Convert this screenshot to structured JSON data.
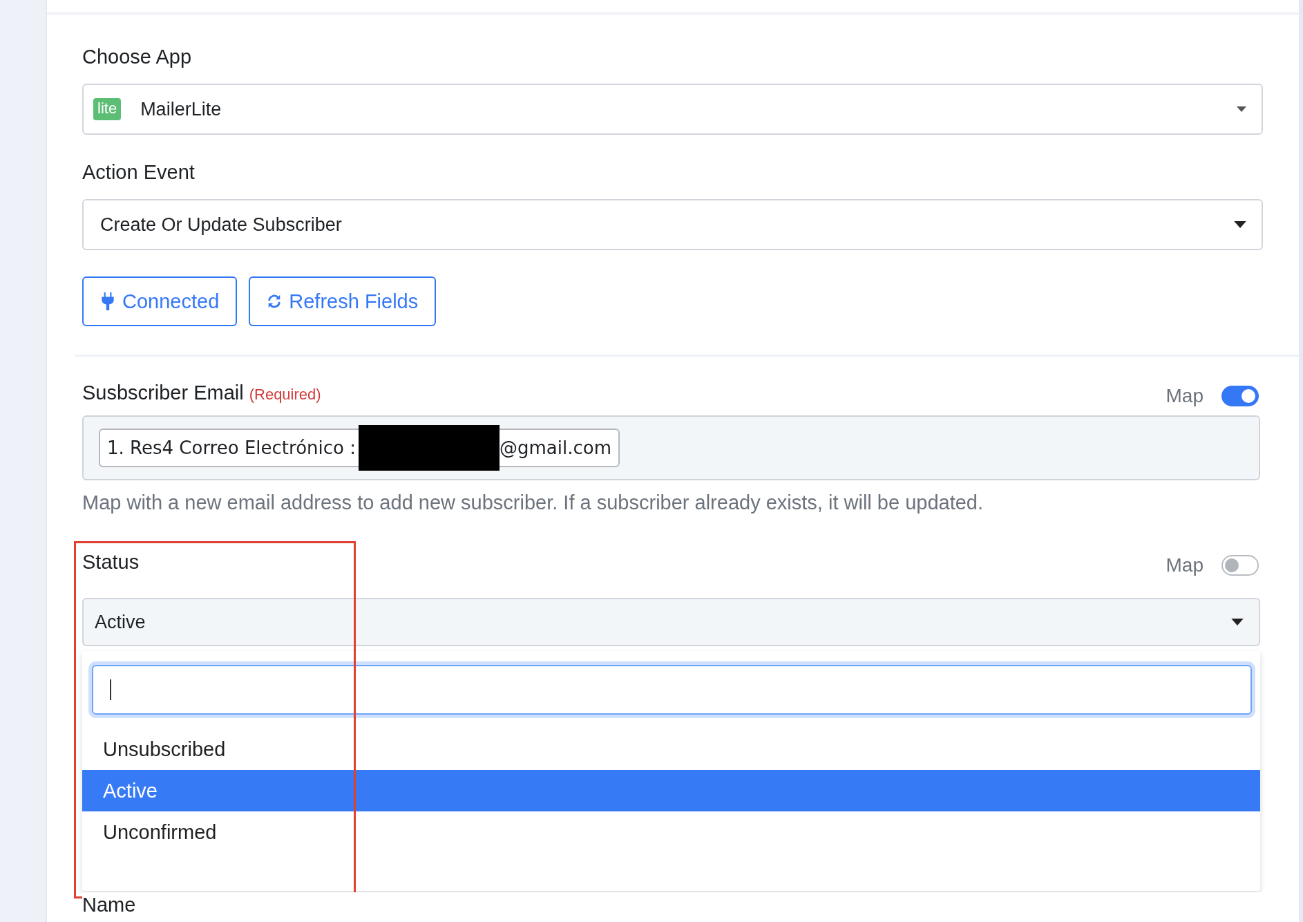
{
  "choose_app": {
    "label": "Choose App",
    "logo": "lite",
    "value": "MailerLite"
  },
  "action_event": {
    "label": "Action Event",
    "value": "Create Or Update Subscriber"
  },
  "buttons": [
    {
      "kind": "plug",
      "label": "Connected"
    },
    {
      "kind": "refresh",
      "label": "Refresh Fields"
    }
  ],
  "subscriber_email": {
    "label": "Susbscriber Email",
    "required": "(Required)",
    "map_label": "Map",
    "map_on": true,
    "tag": {
      "prefix": "1. Res4 Correo Electrónico :",
      "redacted": true,
      "suffix": "@gmail.com"
    },
    "help": "Map with a new email address to add new subscriber. If a subscriber already exists, it will be updated."
  },
  "status": {
    "label": "Status",
    "map_label": "Map",
    "map_on": false,
    "value": "Active",
    "dropdown_open": true,
    "options": [
      {
        "label": "Unsubscribed",
        "selected": false
      },
      {
        "label": "Active",
        "selected": true
      },
      {
        "label": "Unconfirmed",
        "selected": false
      }
    ]
  },
  "next_field": {
    "label": "Name"
  },
  "highlight_box": true
}
